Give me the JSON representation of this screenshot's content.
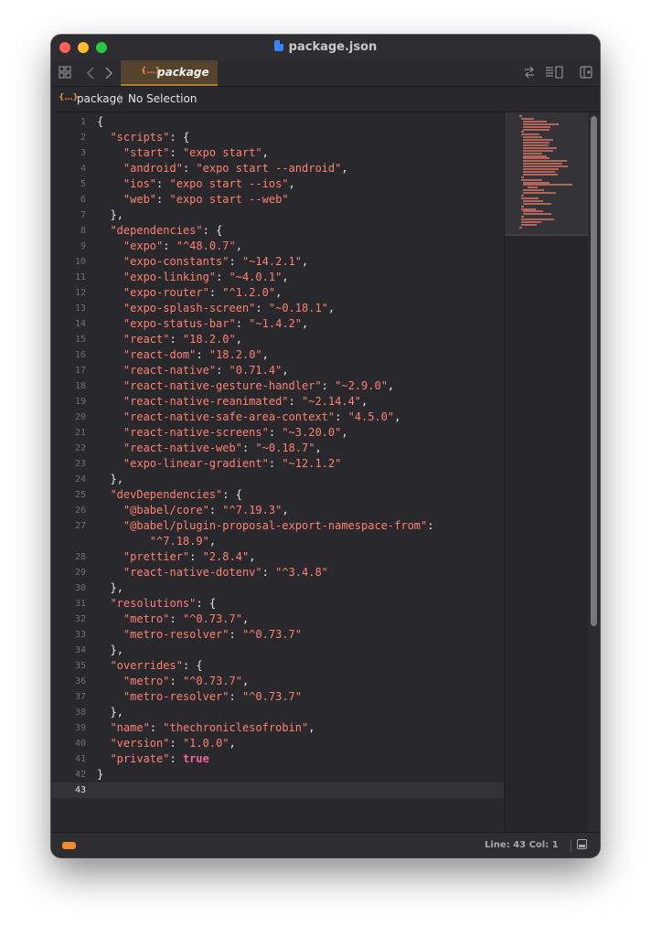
{
  "window": {
    "title": "package.json"
  },
  "toolbar": {
    "tab_label": "package",
    "tab_icon": "{…}",
    "icons": [
      "grid-icon",
      "back-icon",
      "forward-icon",
      "swap-icon",
      "list-icon",
      "add-panel-icon"
    ]
  },
  "breadcrumb": {
    "icon": "{…}",
    "file": "package",
    "selection": "No Selection"
  },
  "editor": {
    "current_line": 43,
    "lines": [
      "{",
      "  \"scripts\": {",
      "    \"start\": \"expo start\",",
      "    \"android\": \"expo start --android\",",
      "    \"ios\": \"expo start --ios\",",
      "    \"web\": \"expo start --web\"",
      "  },",
      "  \"dependencies\": {",
      "    \"expo\": \"^48.0.7\",",
      "    \"expo-constants\": \"~14.2.1\",",
      "    \"expo-linking\": \"~4.0.1\",",
      "    \"expo-router\": \"^1.2.0\",",
      "    \"expo-splash-screen\": \"~0.18.1\",",
      "    \"expo-status-bar\": \"~1.4.2\",",
      "    \"react\": \"18.2.0\",",
      "    \"react-dom\": \"18.2.0\",",
      "    \"react-native\": \"0.71.4\",",
      "    \"react-native-gesture-handler\": \"~2.9.0\",",
      "    \"react-native-reanimated\": \"~2.14.4\",",
      "    \"react-native-safe-area-context\": \"4.5.0\",",
      "    \"react-native-screens\": \"~3.20.0\",",
      "    \"react-native-web\": \"~0.18.7\",",
      "    \"expo-linear-gradient\": \"~12.1.2\"",
      "  },",
      "  \"devDependencies\": {",
      "    \"@babel/core\": \"^7.19.3\",",
      "    \"@babel/plugin-proposal-export-namespace-from\":",
      "        \"^7.18.9\",",
      "    \"prettier\": \"2.8.4\",",
      "    \"react-native-dotenv\": \"^3.4.8\"",
      "  },",
      "  \"resolutions\": {",
      "    \"metro\": \"^0.73.7\",",
      "    \"metro-resolver\": \"^0.73.7\"",
      "  },",
      "  \"overrides\": {",
      "    \"metro\": \"^0.73.7\",",
      "    \"metro-resolver\": \"^0.73.7\"",
      "  },",
      "  \"name\": \"thechroniclesofrobin\",",
      "  \"version\": \"1.0.0\",",
      "  \"private\": true",
      "}",
      ""
    ],
    "gutter": [
      "1",
      "2",
      "3",
      "4",
      "5",
      "6",
      "7",
      "8",
      "9",
      "10",
      "11",
      "12",
      "13",
      "14",
      "15",
      "16",
      "17",
      "18",
      "19",
      "20",
      "21",
      "22",
      "23",
      "24",
      "25",
      "26",
      "27",
      "",
      "28",
      "29",
      "30",
      "31",
      "32",
      "33",
      "34",
      "35",
      "36",
      "37",
      "38",
      "39",
      "40",
      "41",
      "42",
      "43"
    ]
  },
  "statusbar": {
    "position": "Line: 43  Col: 1"
  },
  "colors": {
    "key": "#ff8170",
    "string": "#ff8170",
    "keyword": "#fc5fa3",
    "punct": "#e6e6e6",
    "tab_accent": "#b07a3a",
    "status_pill": "#f28b2c"
  }
}
